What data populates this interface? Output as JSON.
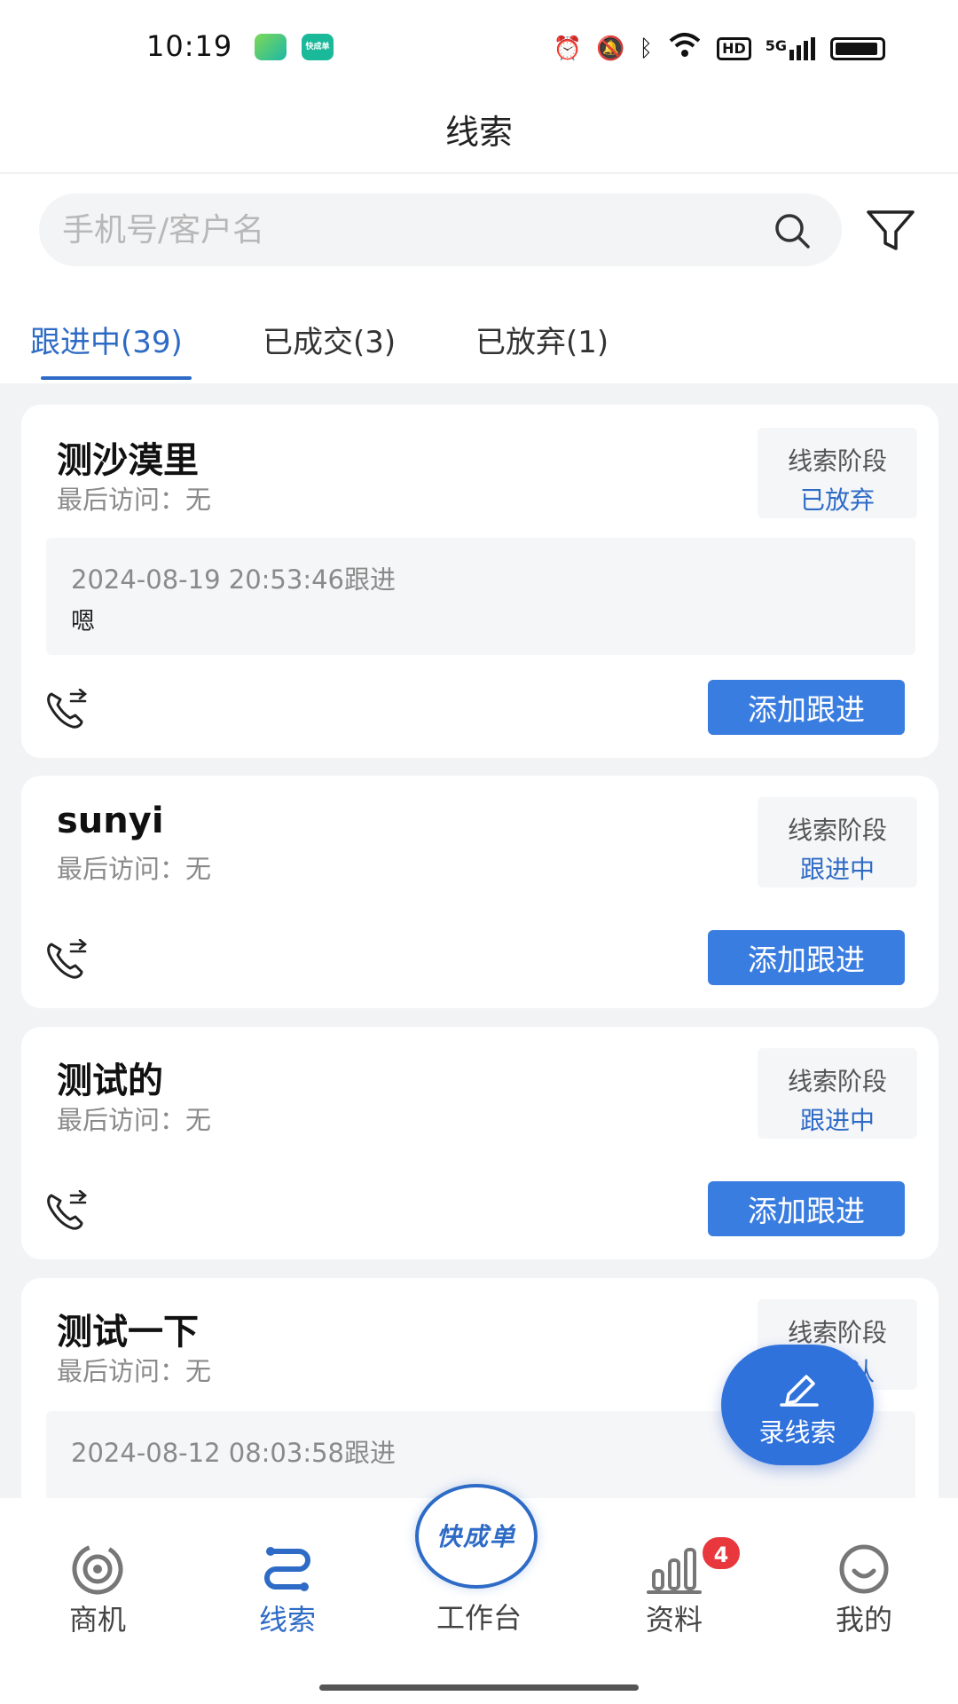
{
  "status_bar": {
    "time": "10:19",
    "app2_label": "快成单",
    "network": "5G",
    "hd": "HD"
  },
  "header": {
    "title": "线索"
  },
  "search": {
    "placeholder": "手机号/客户名",
    "value": ""
  },
  "tabs": [
    {
      "label": "跟进中(39)",
      "active": true
    },
    {
      "label": "已成交(3)",
      "active": false
    },
    {
      "label": "已放弃(1)",
      "active": false
    }
  ],
  "cards": [
    {
      "name": "测沙漠里",
      "visit": "最后访问：无",
      "stage_label": "线索阶段",
      "stage_value": "已放弃",
      "followup_time": "2024-08-19 20:53:46跟进",
      "followup_note": "嗯",
      "button": "添加跟进"
    },
    {
      "name": "sunyi",
      "visit": "最后访问：无",
      "stage_label": "线索阶段",
      "stage_value": "跟进中",
      "button": "添加跟进"
    },
    {
      "name": "测试的",
      "visit": "最后访问：无",
      "stage_label": "线索阶段",
      "stage_value": "跟进中",
      "button": "添加跟进"
    },
    {
      "name": "测试一下",
      "visit": "最后访问：无",
      "stage_label": "线索阶段",
      "stage_value": "待确认",
      "followup_time": "2024-08-12 08:03:58跟进"
    }
  ],
  "fab": {
    "label": "录线索"
  },
  "bottom_nav": [
    {
      "label": "商机",
      "icon": "radar-icon"
    },
    {
      "label": "线索",
      "icon": "route-icon",
      "active": true
    },
    {
      "label": "工作台",
      "logo": "快成单"
    },
    {
      "label": "资料",
      "icon": "bar-chart-icon",
      "badge": "4"
    },
    {
      "label": "我的",
      "icon": "smile-icon"
    }
  ],
  "colors": {
    "accent": "#2e6bc6",
    "button": "#3a7de0",
    "badge": "#e8383d"
  }
}
